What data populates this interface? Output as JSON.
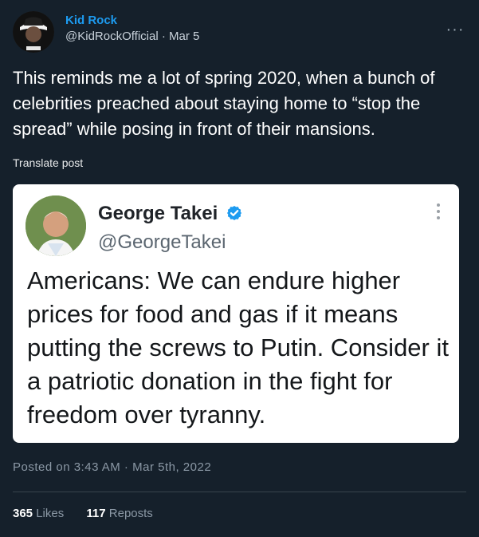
{
  "tweet": {
    "author_name": "Kid Rock",
    "author_handle": "@KidRockOfficial",
    "date_separator": " · ",
    "date": "Mar 5",
    "more_icon": "ellipsis-icon",
    "text": "This reminds me a lot of spring 2020, when a bunch of celebrities preached about staying home to “stop the spread” while posing in front of their mansions.",
    "translate_label": "Translate post"
  },
  "embedded_tweet": {
    "author_name": "George Takei",
    "author_handle": "@GeorgeTakei",
    "verified_icon": "verified-badge-icon",
    "more_icon": "vertical-ellipsis-icon",
    "text": "Americans: We can endure higher prices for food and gas if it means putting the screws to Putin. Consider it a patriotic donation in the fight for freedom over tyranny."
  },
  "footer": {
    "posted_prefix": "Posted on ",
    "posted_time": "3:43 AM",
    "posted_separator": " · ",
    "posted_date": "Mar 5th, 2022",
    "likes_count": "365",
    "likes_label": "Likes",
    "reposts_count": "117",
    "reposts_label": "Reposts"
  },
  "colors": {
    "background": "#15202b",
    "accent": "#1d9bf0",
    "muted": "#8b98a5",
    "embed_background": "#ffffff"
  }
}
